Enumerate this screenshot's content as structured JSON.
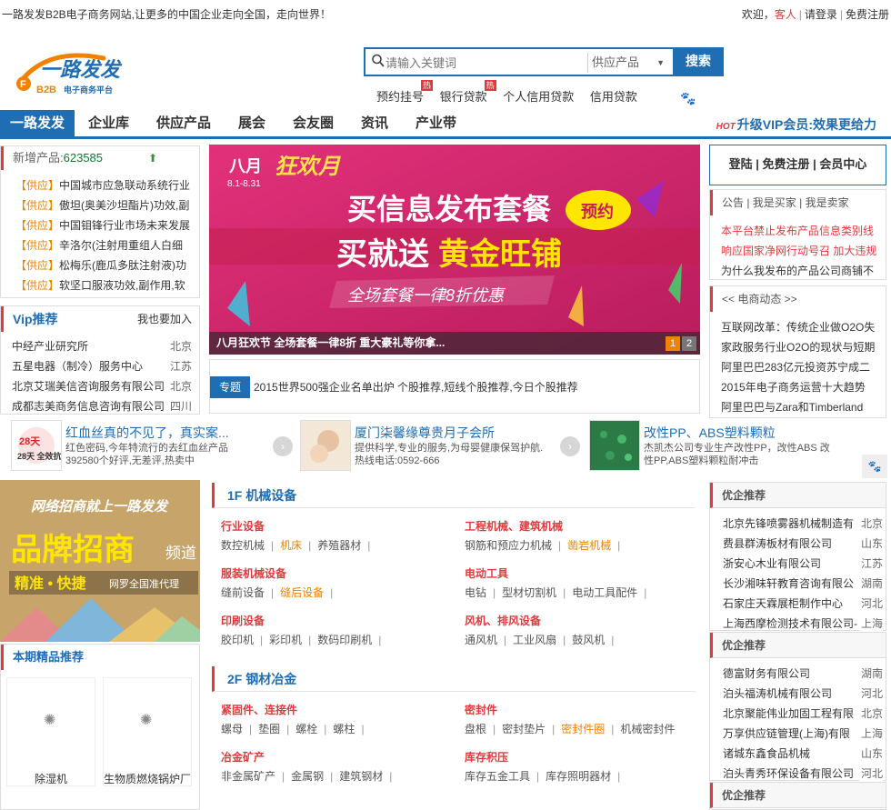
{
  "topbar": {
    "slogan": "一路发发B2B电子商务网站,让更多的中国企业走向全国，走向世界！",
    "welcome": "欢迎，",
    "guest": "客人",
    "login": "请登录",
    "register": "免费注册"
  },
  "logo": {
    "main": "一路发发",
    "sub1": "B2B",
    "sub2": "电子商务平台"
  },
  "search": {
    "placeholder": "请输入关键词",
    "category": "供应产品",
    "button": "搜索"
  },
  "hotlinks": [
    {
      "label": "预约挂号",
      "tag": "热"
    },
    {
      "label": "银行贷款",
      "tag": "热"
    },
    {
      "label": "个人信用贷款",
      "tag": ""
    },
    {
      "label": "信用贷款",
      "tag": ""
    }
  ],
  "nav": {
    "items": [
      "一路发发",
      "企业库",
      "供应产品",
      "展会",
      "会友圈",
      "资讯",
      "产业带"
    ],
    "vip_hot": "HOT",
    "vip_text": "升级VIP会员:效果更给力"
  },
  "newprod": {
    "label": "新增产品:",
    "count": "623585",
    "items": [
      {
        "tag": "【供应】",
        "text": "中国城市应急联动系统行业"
      },
      {
        "tag": "【供应】",
        "text": "傲坦(奥美沙坦酯片)功效,副"
      },
      {
        "tag": "【供应】",
        "text": "中国钼锋行业市场未来发展"
      },
      {
        "tag": "【供应】",
        "text": "辛洛尔(注射用重组人白细"
      },
      {
        "tag": "【供应】",
        "text": "松梅乐(鹿瓜多肽注射液)功"
      },
      {
        "tag": "【供应】",
        "text": "软坚口服液功效,副作用,软"
      }
    ]
  },
  "viprec": {
    "title": "Vip推荐",
    "join": "我也要加入",
    "items": [
      {
        "name": "中经产业研究所",
        "region": "北京"
      },
      {
        "name": "五星电器（制冷）服务中心",
        "region": "江苏"
      },
      {
        "name": "北京艾瑞美信咨询服务有限公司",
        "region": "北京"
      },
      {
        "name": "成都志美商务信息咨询有限公司",
        "region": "四川"
      }
    ]
  },
  "banner": {
    "month": "八月",
    "carnival": "狂欢月",
    "date": "8.1-8.31",
    "line1": "买信息发布套餐",
    "booking": "预约",
    "line2a": "买就送",
    "line2b": "黄金旺铺",
    "line3": "全场套餐一律8折优惠",
    "caption": "八月狂欢节 全场套餐一律8折 重大豪礼等你拿...",
    "pages": [
      "1",
      "2"
    ]
  },
  "special": {
    "tag": "专题",
    "text": "2015世界500强企业名单出炉    个股推荐,短线个股推荐,今日个股推荐"
  },
  "login_box": {
    "login": "登陆",
    "register": "免费注册",
    "member": "会员中心"
  },
  "notice": {
    "tabs": "公告 | 我是买家 | 我是卖家",
    "line1": "本平台禁止发布产品信息类别线",
    "line2": "响应国家净网行动号召 加大违规",
    "line3": "为什么我发布的产品公司商铺不"
  },
  "news": {
    "title": "<< 电商动态 >>",
    "items": [
      "互联网改革：传统企业做O2O失",
      "家政服务行业O2O的现状与短期",
      "阿里巴巴283亿元投资苏宁成二",
      "2015年电子商务运营十大趋势",
      "阿里巴巴与Zara和Timberland"
    ]
  },
  "ads": [
    {
      "pic": "28天 全效抗红",
      "title": "红血丝真的不见了，真实案...",
      "d1": "红色密码,今年特流行的去红血丝产品",
      "d2": "392580个好评,无差评,热卖中"
    },
    {
      "pic": "",
      "title": "厦门柒馨缘尊贵月子会所",
      "d1": "提供科学,专业的服务,为母婴健康保驾护航.",
      "d2": "热线电话:0592-666"
    },
    {
      "pic": "",
      "title": "改性PP、ABS塑料颗粒",
      "d1": "杰凯杰公司专业生产改性PP，改性ABS 改",
      "d2": "性PP,ABS塑料颗粒耐冲击"
    }
  ],
  "zhaoshang": {
    "l1": "网络招商就上一路发发",
    "l2": "品牌招商",
    "l3": "频道",
    "l4": "精准 • 快捷",
    "l5": "网罗全国准代理"
  },
  "featured": {
    "title": "本期精品推荐",
    "items": [
      "除湿机",
      "生物质燃烧锅炉厂"
    ]
  },
  "floors": [
    {
      "title": "1F 机械设备",
      "sections": [
        {
          "title": "行业设备",
          "items": [
            {
              "t": "数控机械",
              "h": false
            },
            {
              "t": "机床",
              "h": true
            },
            {
              "t": "养殖器材",
              "h": false
            }
          ]
        },
        {
          "title": "工程机械、建筑机械",
          "items": [
            {
              "t": "钢筋和预应力机械",
              "h": false
            },
            {
              "t": "凿岩机械",
              "h": true
            }
          ]
        },
        {
          "title": "服装机械设备",
          "items": [
            {
              "t": "缝前设备",
              "h": false
            },
            {
              "t": "缝后设备",
              "h": true
            }
          ]
        },
        {
          "title": "电动工具",
          "items": [
            {
              "t": "电钻",
              "h": false
            },
            {
              "t": "型材切割机",
              "h": false
            },
            {
              "t": "电动工具配件",
              "h": false
            }
          ]
        },
        {
          "title": "印刷设备",
          "items": [
            {
              "t": "胶印机",
              "h": false
            },
            {
              "t": "彩印机",
              "h": false
            },
            {
              "t": "数码印刷机",
              "h": false
            }
          ]
        },
        {
          "title": "风机、排风设备",
          "items": [
            {
              "t": "通风机",
              "h": false
            },
            {
              "t": "工业风扇",
              "h": false
            },
            {
              "t": "鼓风机",
              "h": false
            }
          ]
        }
      ]
    },
    {
      "title": "2F 钢材冶金",
      "sections": [
        {
          "title": "紧固件、连接件",
          "items": [
            {
              "t": "螺母",
              "h": false
            },
            {
              "t": "垫圈",
              "h": false
            },
            {
              "t": "螺栓",
              "h": false
            },
            {
              "t": "螺柱",
              "h": false
            }
          ]
        },
        {
          "title": "密封件",
          "items": [
            {
              "t": "盘根",
              "h": false
            },
            {
              "t": "密封垫片",
              "h": false
            },
            {
              "t": "密封件圈",
              "h": true
            },
            {
              "t": "机械密封件",
              "h": false
            }
          ]
        },
        {
          "title": "冶金矿产",
          "items": [
            {
              "t": "非金属矿产",
              "h": false
            },
            {
              "t": "金属钢",
              "h": false
            },
            {
              "t": "建筑钢材",
              "h": false
            }
          ]
        },
        {
          "title": "库存积压",
          "items": [
            {
              "t": "库存五金工具",
              "h": false
            },
            {
              "t": "库存照明器材",
              "h": false
            }
          ]
        }
      ]
    }
  ],
  "rboxes": [
    {
      "title": "优企推荐",
      "items": [
        {
          "name": "北京先锋喷雾器机械制造有",
          "region": "北京"
        },
        {
          "name": "费县群涛板材有限公司",
          "region": "山东"
        },
        {
          "name": "浙安心木业有限公司",
          "region": "江苏"
        },
        {
          "name": "长沙湘味轩教育咨询有限公",
          "region": "湖南"
        },
        {
          "name": "石家庄天霖展柜制作中心",
          "region": "河北"
        },
        {
          "name": "上海西摩检测技术有限公司-",
          "region": "上海"
        }
      ]
    },
    {
      "title": "优企推荐",
      "items": [
        {
          "name": "德富财务有限公司",
          "region": "湖南"
        },
        {
          "name": "泊头福涛机械有限公司",
          "region": "河北"
        },
        {
          "name": "北京聚能伟业加固工程有限",
          "region": "北京"
        },
        {
          "name": "万享供应链管理(上海)有限",
          "region": "上海"
        },
        {
          "name": "诸城东鑫食品机械",
          "region": "山东"
        },
        {
          "name": "泊头青秀环保设备有限公司",
          "region": "河北"
        }
      ]
    },
    {
      "title": "优企推荐",
      "items": []
    }
  ],
  "colors": {
    "brand_blue": "#1f6db3",
    "accent_red": "#e4393c",
    "highlight_orange": "#f08200"
  },
  "icons": {
    "search": "search-icon",
    "paw": "paw-icon",
    "next": "chevron-right-icon",
    "loading": "spinner-icon"
  }
}
